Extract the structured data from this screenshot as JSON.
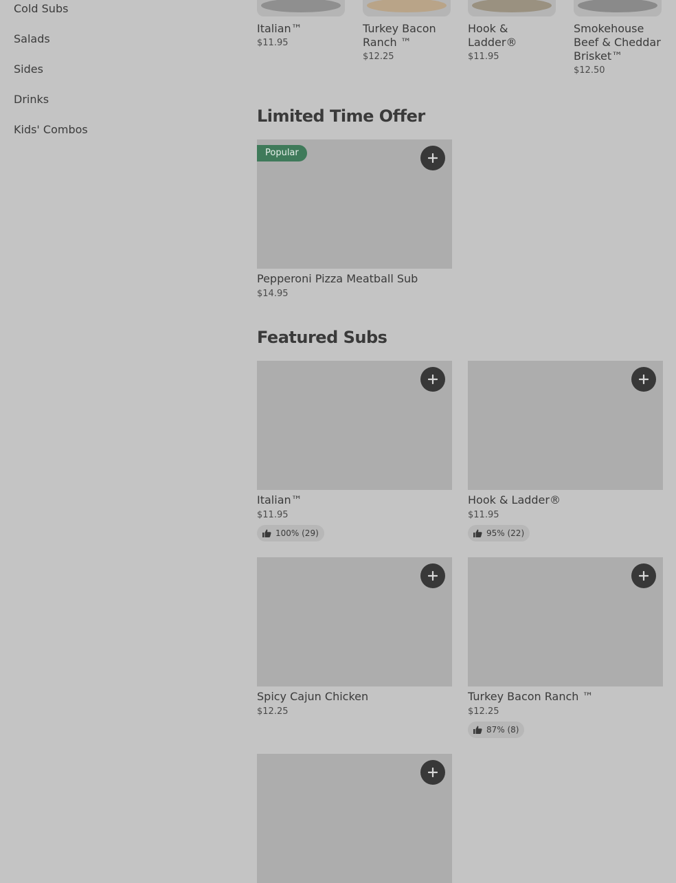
{
  "sidebar": {
    "items": [
      {
        "label": "Cold Subs"
      },
      {
        "label": "Salads"
      },
      {
        "label": "Sides"
      },
      {
        "label": "Drinks"
      },
      {
        "label": "Kids' Combos"
      }
    ]
  },
  "top_items": [
    {
      "name": "Italian™",
      "price": "$11.95"
    },
    {
      "name": "Turkey Bacon Ranch ™",
      "price": "$12.25"
    },
    {
      "name": "Hook & Ladder®",
      "price": "$11.95"
    },
    {
      "name": "Smokehouse Beef & Cheddar Brisket™",
      "price": "$12.50"
    }
  ],
  "limited": {
    "title": "Limited Time Offer",
    "items": [
      {
        "name": "Pepperoni Pizza Meatball Sub",
        "price": "$14.95",
        "badge": "Popular"
      }
    ]
  },
  "featured": {
    "title": "Featured Subs",
    "items": [
      {
        "name": "Italian™",
        "price": "$11.95",
        "rating": "100% (29)"
      },
      {
        "name": "Hook & Ladder®",
        "price": "$11.95",
        "rating": "95% (22)"
      },
      {
        "name": "Spicy Cajun Chicken",
        "price": "$12.25"
      },
      {
        "name": "Turkey Bacon Ranch ™",
        "price": "$12.25",
        "rating": "87% (8)"
      }
    ]
  },
  "icons": {
    "add": "plus-icon",
    "rating": "thumbs-up-icon"
  },
  "colors": {
    "badge": "#3f7a5a",
    "add_button": "#383838",
    "overlay": "#c4c4c4"
  }
}
